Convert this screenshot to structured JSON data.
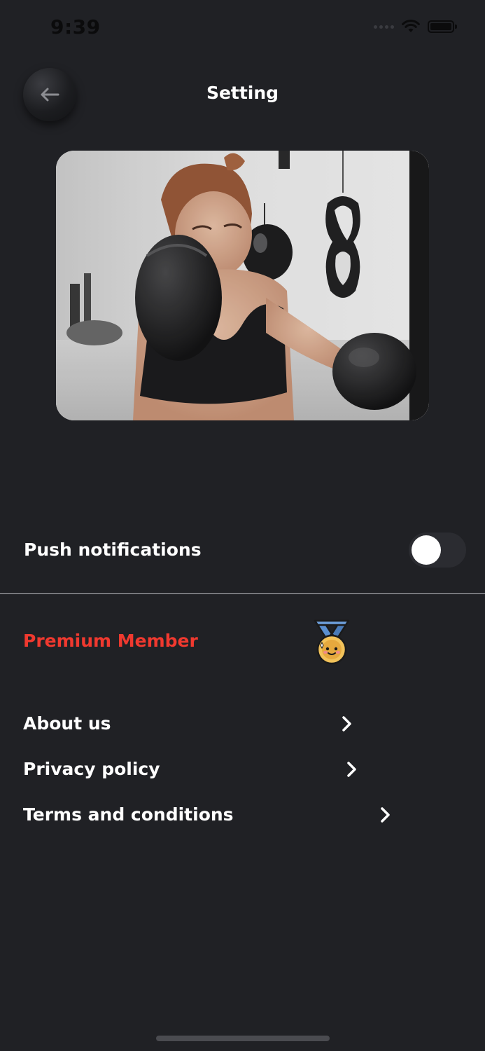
{
  "status_bar": {
    "time": "9:39"
  },
  "header": {
    "title": "Setting",
    "back_icon": "arrow-left-icon"
  },
  "hero_image": {
    "subject": "woman-boxing-photo"
  },
  "settings": {
    "push_notifications_label": "Push notifications",
    "push_notifications_enabled": false,
    "premium_label": "Premium Member",
    "premium_color": "#f0392f",
    "premium_icon": "medal-icon"
  },
  "menu": {
    "items": [
      {
        "label": "About us",
        "icon": "chevron-right-icon"
      },
      {
        "label": "Privacy policy",
        "icon": "chevron-right-icon"
      },
      {
        "label": "Terms and conditions",
        "icon": "chevron-right-icon"
      }
    ]
  },
  "colors": {
    "background": "#202125",
    "text": "#ffffff",
    "accent_red": "#f0392f",
    "toggle_track": "#2b2c31"
  }
}
